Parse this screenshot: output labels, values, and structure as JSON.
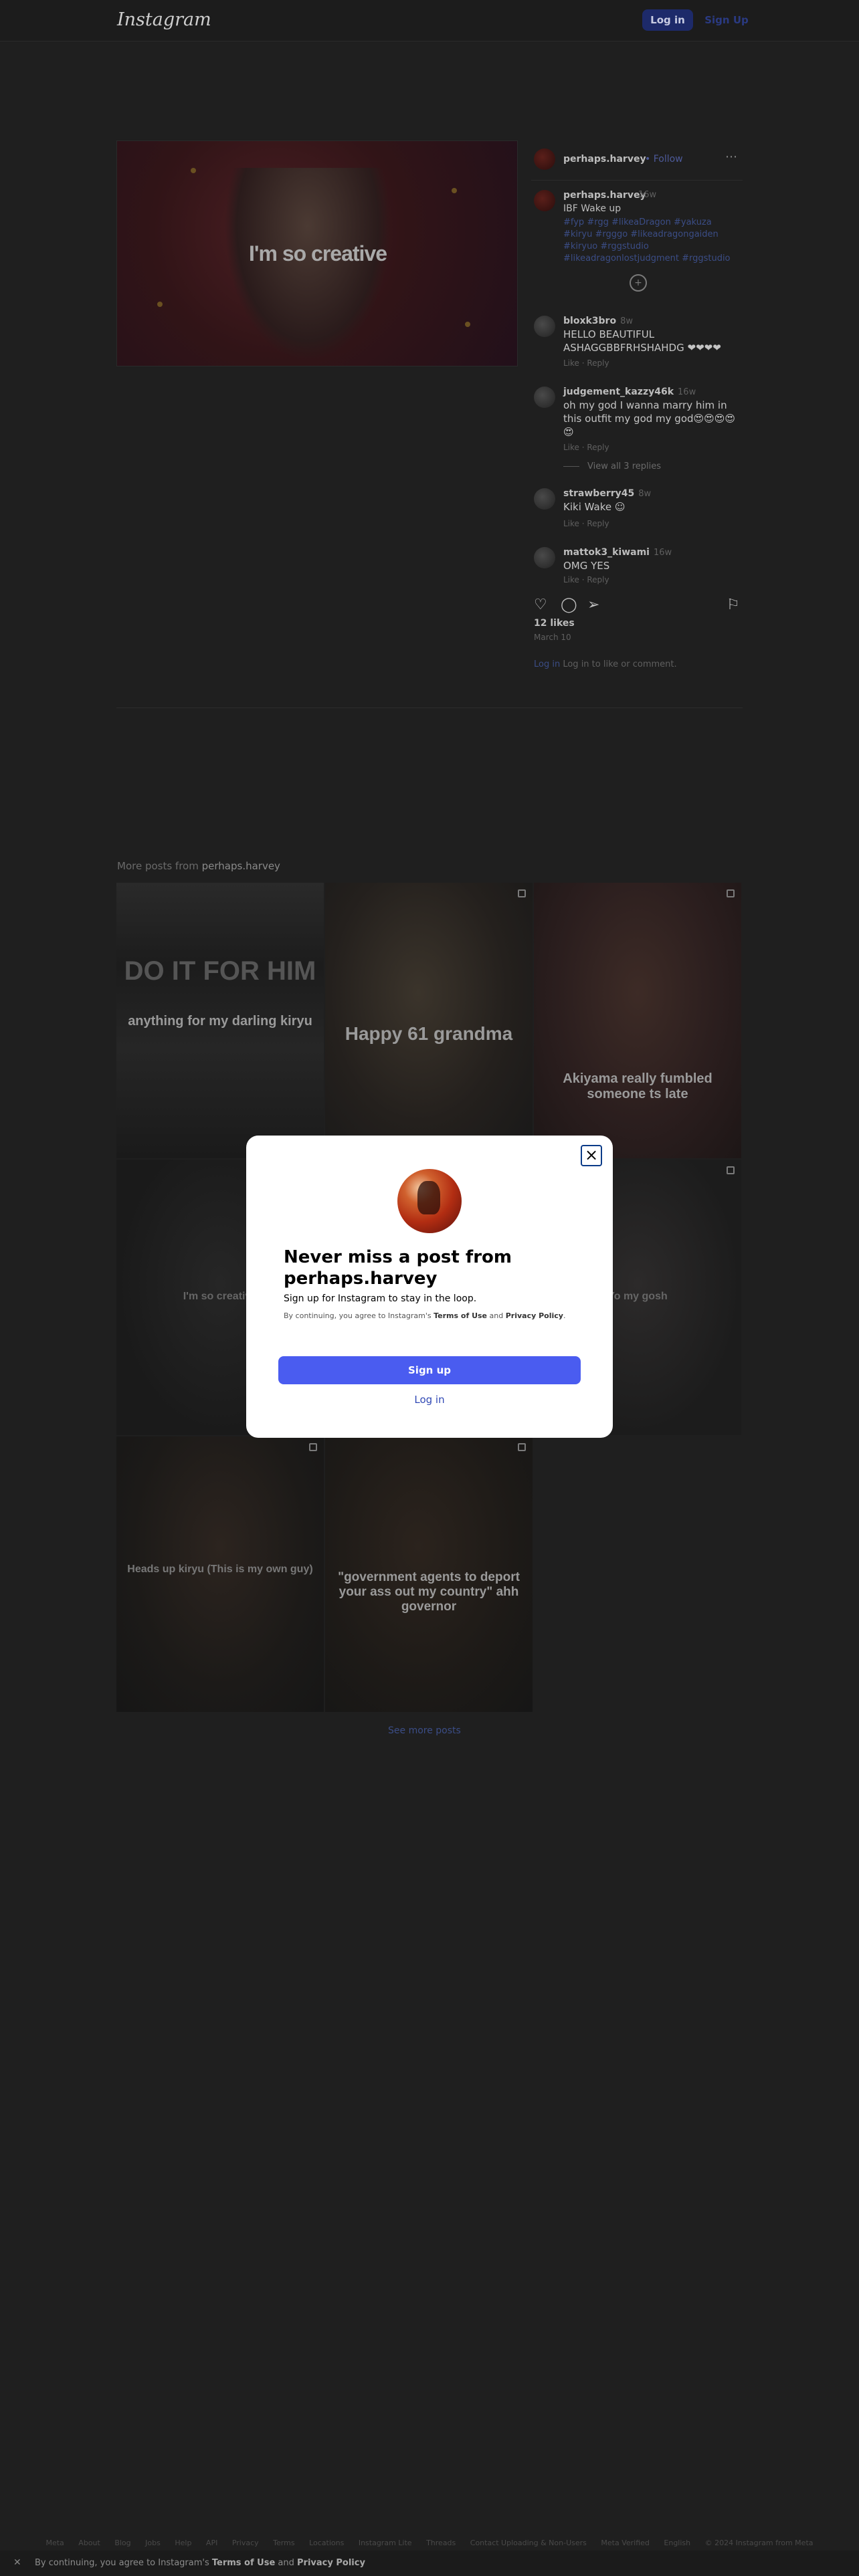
{
  "header": {
    "logo_text": "Instagram",
    "login_label": "Log in",
    "signup_label": "Sign Up"
  },
  "post": {
    "image_caption": "I'm so creative",
    "username": "perhaps.harvey",
    "follow_label": "Follow",
    "more_icon": "more-horizontal-icon",
    "caption": {
      "username": "perhaps.harvey",
      "time": "16w",
      "text": "IBF Wake up",
      "hashtags": "#fyp #rgg #likeaDragon #yakuza #kiryu #rgggo #likeadragongaiden #kiryuo #rggstudio #likeadragonlostjudgment #rggstudio"
    },
    "comments": [
      {
        "username": "bloxk3bro",
        "time": "8w",
        "text": "HELLO BEAUTIFUL ASHAGGBBFRHSHAHDG ❤❤❤❤",
        "meta": "Like · Reply"
      },
      {
        "username": "judgement_kazzy46k",
        "time": "16w",
        "text": "oh my god I wanna marry him in this outfit my god my god😍😍😍😍😍",
        "meta": "Like · Reply",
        "replies": "View all 3 replies"
      },
      {
        "username": "strawberry45",
        "time": "8w",
        "text": "Kiki Wake ☺",
        "meta": "Like · Reply"
      },
      {
        "username": "mattok3_kiwami",
        "time": "16w",
        "text": "OMG YES",
        "meta": "Like · Reply"
      }
    ],
    "likes": "12 likes",
    "age": "March 10",
    "login_hint_prefix": "Log in to like or comment.",
    "login_hint_link": "Log in"
  },
  "more_posts": {
    "title_prefix": "More posts from",
    "username": "perhaps.harvey",
    "tiles": [
      {
        "caption": "anything for my darling kiryu",
        "header": "DO IT FOR HIM"
      },
      {
        "caption": "Happy 61 grandma",
        "header": ""
      },
      {
        "caption": "Akiyama really fumbled someone ts late",
        "header": ""
      },
      {
        "caption": "I'm so creative",
        "header": ""
      },
      {
        "caption": "",
        "header": ""
      },
      {
        "caption": "Yo my gosh",
        "header": ""
      },
      {
        "caption": "Heads up kiryu (This is my own guy)",
        "header": ""
      },
      {
        "caption": "\"government agents to deport your ass out my country\" ahh governor",
        "header": ""
      }
    ],
    "see_more": "See more posts"
  },
  "modal": {
    "close_icon": "close-icon",
    "title": "Never miss a post from perhaps.harvey",
    "subtitle": "Sign up for Instagram to stay in the loop.",
    "terms_prefix": "By continuing, you agree to Instagram's",
    "terms_link": "Terms of Use",
    "terms_and": "and",
    "privacy_link": "Privacy Policy",
    "signup_label": "Sign up",
    "login_label": "Log in"
  },
  "footer": {
    "links": [
      "Meta",
      "About",
      "Blog",
      "Jobs",
      "Help",
      "API",
      "Privacy",
      "Terms",
      "Locations",
      "Instagram Lite",
      "Threads",
      "Contact Uploading & Non-Users",
      "Meta Verified",
      "English",
      "© 2024 Instagram from Meta"
    ]
  },
  "cookie_bar": {
    "prefix": "By continuing, you agree to Instagram's",
    "terms": "Terms of Use",
    "and": "and",
    "privacy": "Privacy Policy"
  },
  "colors": {
    "accent": "#4a5cf0",
    "link": "#3149b5",
    "overlay_background": "#1f1f1f"
  }
}
